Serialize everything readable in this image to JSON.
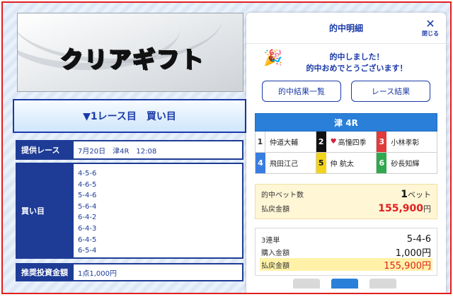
{
  "logo": {
    "text": "クリアギフト"
  },
  "left": {
    "race_button": "▼1レース目　買い目",
    "rows": {
      "race": {
        "label": "提供レース",
        "value": "7月20日　津4R　12:08"
      },
      "bets": {
        "label": "買い目",
        "values": [
          "4-5-6",
          "4-6-5",
          "5-4-6",
          "5-6-4",
          "6-4-2",
          "6-4-3",
          "6-4-5",
          "6-5-4"
        ]
      },
      "amount": {
        "label": "推奨投資金額",
        "value": "1点1,000円"
      }
    }
  },
  "panel": {
    "title": "的中明細",
    "close_label": "閉じる",
    "congrats_line1": "的中しました！",
    "congrats_line2": "的中おめでとうございます！",
    "buttons": {
      "results_list": "的中結果一覧",
      "race_results": "レース結果"
    },
    "race": "津 4R",
    "racers": [
      {
        "num": "1",
        "name": "仲道大輔"
      },
      {
        "num": "2",
        "name": "高憧四季",
        "heart": true
      },
      {
        "num": "3",
        "name": "小林孝彰"
      },
      {
        "num": "4",
        "name": "飛田江己"
      },
      {
        "num": "5",
        "name": "仲 航太"
      },
      {
        "num": "6",
        "name": "砂長知輝"
      }
    ],
    "summary": {
      "bet_count_label": "的中ベット数",
      "bet_count_value": "1",
      "bet_count_unit": "ベット",
      "payout_label": "払戻金額",
      "payout_value": "155,900",
      "payout_unit": "円"
    },
    "detail": {
      "type": "3連単",
      "combo": "5-4-6",
      "purchase_label": "購入金額",
      "purchase_value": "1,000円",
      "payout_label": "払戻金額",
      "payout_value": "155,900円"
    }
  },
  "colors": {
    "accent": "#1a3aa8",
    "header_blue": "#2a7fd8",
    "payout_red": "#e02020",
    "frame_red": "#e02020"
  }
}
